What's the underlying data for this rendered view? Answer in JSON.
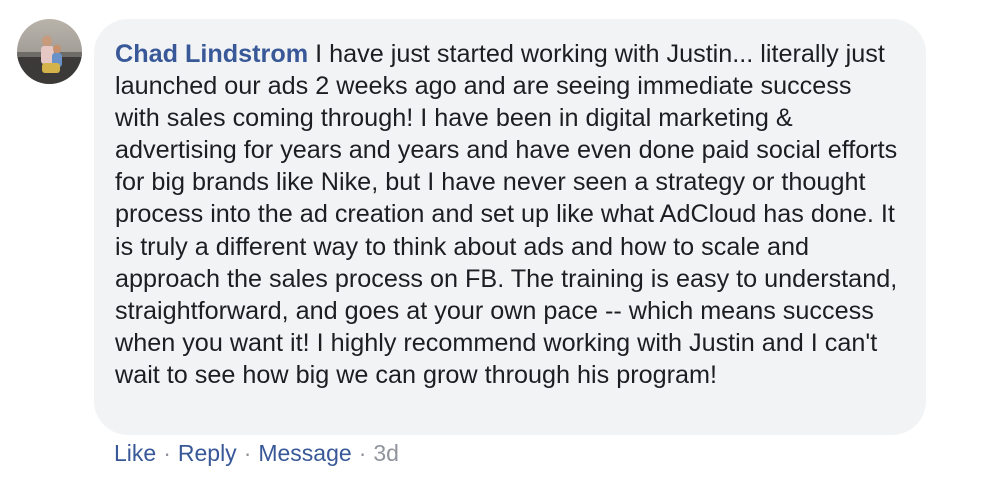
{
  "comment": {
    "author": "Chad Lindstrom",
    "body": "I have just started working with Justin... literally just launched our ads 2 weeks ago and are seeing immediate success with sales coming through! I have been in digital marketing & advertising for years and years and have even done paid social efforts for big brands like Nike, but I have never seen a strategy or thought process into the ad creation and set up like what AdCloud has done. It is truly a different way to think about ads and how to scale and approach the sales process on FB. The training is easy to understand, straightforward, and goes at your own pace -- which means success when you want it! I highly recommend working with Justin and I can't wait to see how big we can grow through his program!"
  },
  "actions": {
    "like": "Like",
    "reply": "Reply",
    "message": "Message",
    "separator": "·",
    "timestamp": "3d"
  },
  "colors": {
    "author_link": "#385898",
    "bubble_bg": "#f2f3f5",
    "body_text": "#1c1e21",
    "meta_text": "#90949c"
  }
}
